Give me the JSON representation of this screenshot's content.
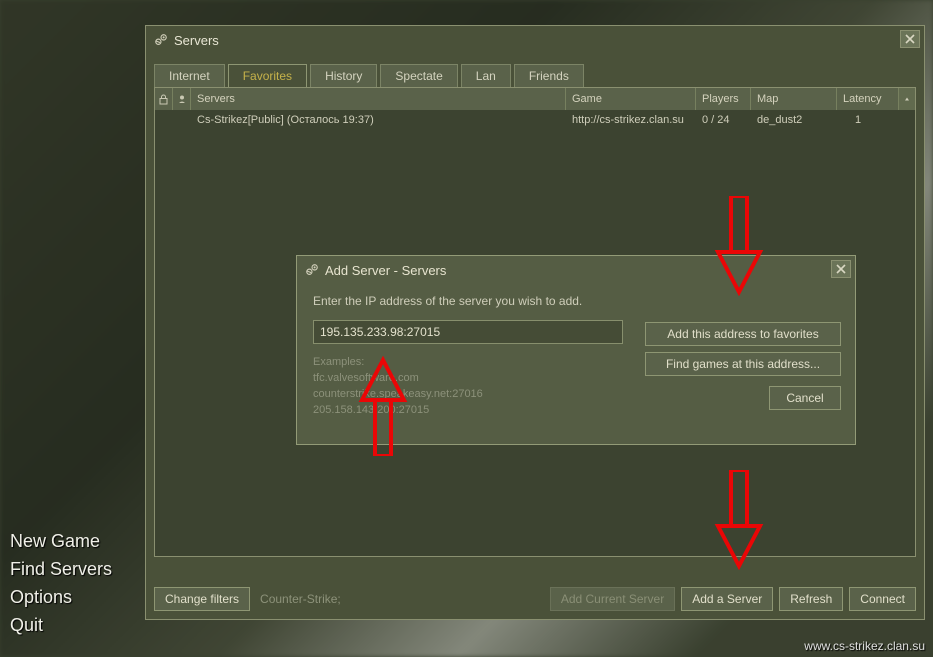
{
  "main_menu": {
    "new_game": "New Game",
    "find_servers": "Find Servers",
    "options": "Options",
    "quit": "Quit"
  },
  "servers_window": {
    "title": "Servers",
    "tabs": {
      "internet": "Internet",
      "favorites": "Favorites",
      "history": "History",
      "spectate": "Spectate",
      "lan": "Lan",
      "friends": "Friends"
    },
    "columns": {
      "servers": "Servers",
      "game": "Game",
      "players": "Players",
      "map": "Map",
      "latency": "Latency"
    },
    "rows": [
      {
        "name": "Cs-Strikez[Public] (Осталось 19:37)",
        "game": "http://cs-strikez.clan.su",
        "players": "0 / 24",
        "map": "de_dust2",
        "latency": "1"
      }
    ],
    "footer": {
      "change_filters": "Change filters",
      "filter_text": "Counter-Strike;",
      "add_current": "Add Current Server",
      "add_server": "Add a Server",
      "refresh": "Refresh",
      "connect": "Connect"
    }
  },
  "dialog": {
    "title": "Add Server - Servers",
    "prompt": "Enter the IP address of the server you wish to add.",
    "ip_value": "195.135.233.98:27015",
    "examples_label": "Examples:",
    "example1": "tfc.valvesoftware.com",
    "example2": "counterstrike.speakeasy.net:27016",
    "example3": "205.158.143.200:27015",
    "btn_add_fav": "Add this address to favorites",
    "btn_find_games": "Find games at this address...",
    "btn_cancel": "Cancel"
  },
  "watermark": "www.cs-strikez.clan.su"
}
